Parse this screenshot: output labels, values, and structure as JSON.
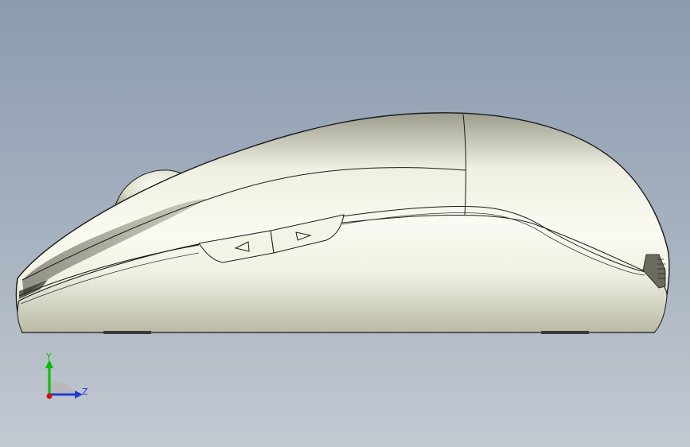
{
  "viewport": {
    "background_top": "#8b9bb0",
    "background_bottom": "#c3c9d1"
  },
  "model": {
    "body_color": "#e6e6d2",
    "edge_color": "#1a1a1a"
  },
  "side_buttons": [
    {
      "name": "back-button",
      "glyph": "left-triangle-icon"
    },
    {
      "name": "forward-button",
      "glyph": "right-triangle-icon"
    }
  ],
  "triad": {
    "y_label": "Y",
    "z_label": "Z",
    "y_color": "#00c000",
    "z_color": "#1f3bd6",
    "x_color": "#d01010"
  }
}
